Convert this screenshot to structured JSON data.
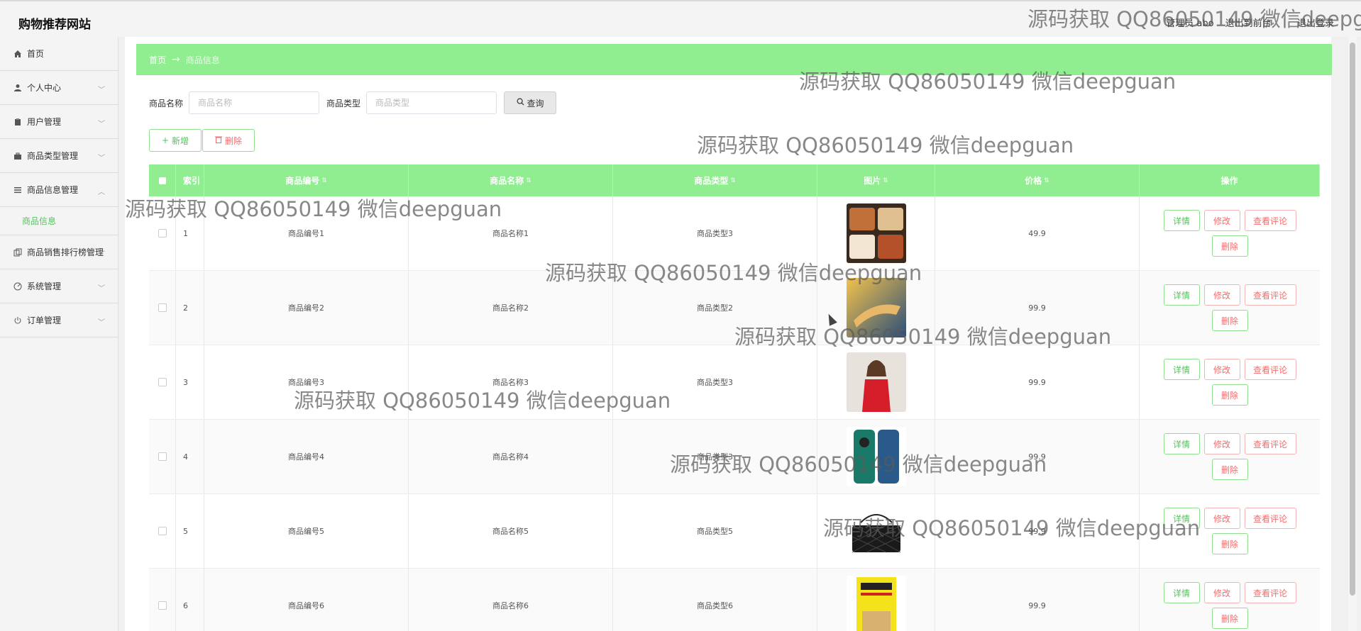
{
  "header": {
    "site_title": "购物推荐网站",
    "user_label": "管理员 abo",
    "back_front": "退出到前台",
    "logout": "退出登录"
  },
  "sidebar": {
    "items": [
      {
        "label": "首页",
        "icon": "home-icon"
      },
      {
        "label": "个人中心",
        "icon": "user-icon"
      },
      {
        "label": "用户管理",
        "icon": "clipboard-icon"
      },
      {
        "label": "商品类型管理",
        "icon": "briefcase-icon"
      },
      {
        "label": "商品信息管理",
        "icon": "list-icon"
      },
      {
        "label": "商品信息",
        "sub": true
      },
      {
        "label": "商品销售排行榜管理",
        "icon": "copy-icon"
      },
      {
        "label": "系统管理",
        "icon": "dashboard-icon"
      },
      {
        "label": "订单管理",
        "icon": "power-icon"
      }
    ]
  },
  "breadcrumb": {
    "home": "首页",
    "arrow": "→",
    "current": "商品信息"
  },
  "search": {
    "name_label": "商品名称",
    "name_placeholder": "商品名称",
    "type_label": "商品类型",
    "type_placeholder": "商品类型",
    "query_label": "查询"
  },
  "actions": {
    "add_label": "新增",
    "delete_label": "删除"
  },
  "table": {
    "headers": {
      "index": "索引",
      "number": "商品编号",
      "name": "商品名称",
      "type": "商品类型",
      "image": "图片",
      "price": "价格",
      "op": "操作"
    },
    "ops": {
      "detail": "详情",
      "edit": "修改",
      "review": "查看评论",
      "delete": "删除"
    },
    "rows": [
      {
        "index": "1",
        "number": "商品编号1",
        "name": "商品名称1",
        "type": "商品类型3",
        "price": "49.9"
      },
      {
        "index": "2",
        "number": "商品编号2",
        "name": "商品名称2",
        "type": "商品类型2",
        "price": "99.9"
      },
      {
        "index": "3",
        "number": "商品编号3",
        "name": "商品名称3",
        "type": "商品类型3",
        "price": "99.9"
      },
      {
        "index": "4",
        "number": "商品编号4",
        "name": "商品名称4",
        "type": "商品类型3",
        "price": "99.9"
      },
      {
        "index": "5",
        "number": "商品编号5",
        "name": "商品名称5",
        "type": "商品类型5",
        "price": "99.9"
      },
      {
        "index": "6",
        "number": "商品编号6",
        "name": "商品名称6",
        "type": "商品类型6",
        "price": "99.9"
      }
    ]
  },
  "watermark": "源码获取 QQ86050149 微信deepguan",
  "colors": {
    "accent": "#90ee90",
    "green_text": "#52c45a",
    "red_text": "#f56c6c"
  }
}
